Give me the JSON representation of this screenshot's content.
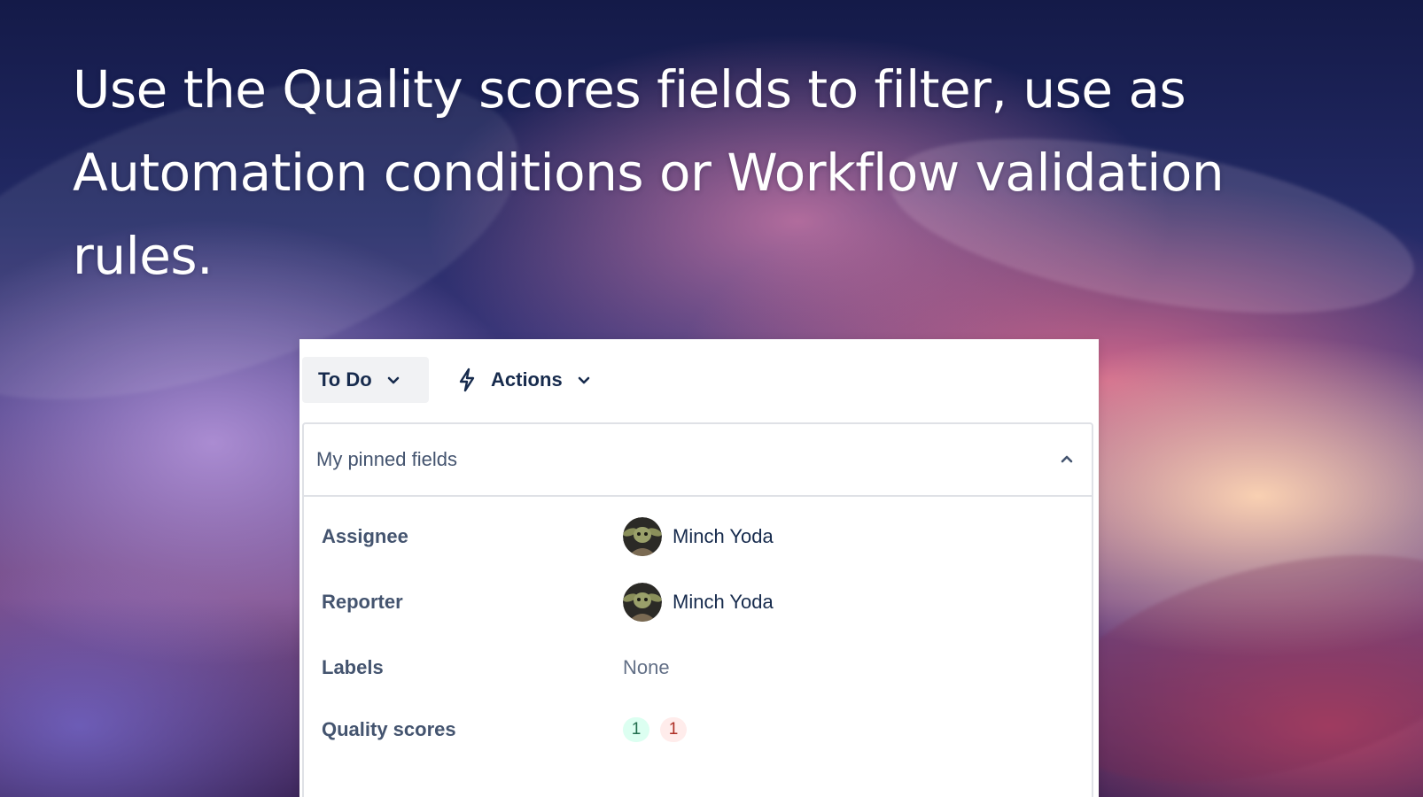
{
  "headline": "Use the Quality scores fields to filter, use as Automation conditions or Workflow validation rules.",
  "toolbar": {
    "status_label": "To Do",
    "status_chevron_icon": "chevron-down-icon",
    "actions_label": "Actions",
    "actions_icon": "lightning-bolt-icon"
  },
  "pinned_fields": {
    "title": "My pinned fields",
    "collapse_icon": "chevron-up-icon",
    "rows": [
      {
        "label": "Assignee",
        "value": "Minch Yoda",
        "avatar": "yoda-avatar"
      },
      {
        "label": "Reporter",
        "value": "Minch Yoda",
        "avatar": "yoda-avatar"
      },
      {
        "label": "Labels",
        "value": "None"
      },
      {
        "label": "Quality scores",
        "badges": [
          {
            "value": "1",
            "status": "good",
            "color": "#dcfff1"
          },
          {
            "value": "1",
            "status": "bad",
            "color": "#ffeceb"
          }
        ]
      }
    ]
  }
}
